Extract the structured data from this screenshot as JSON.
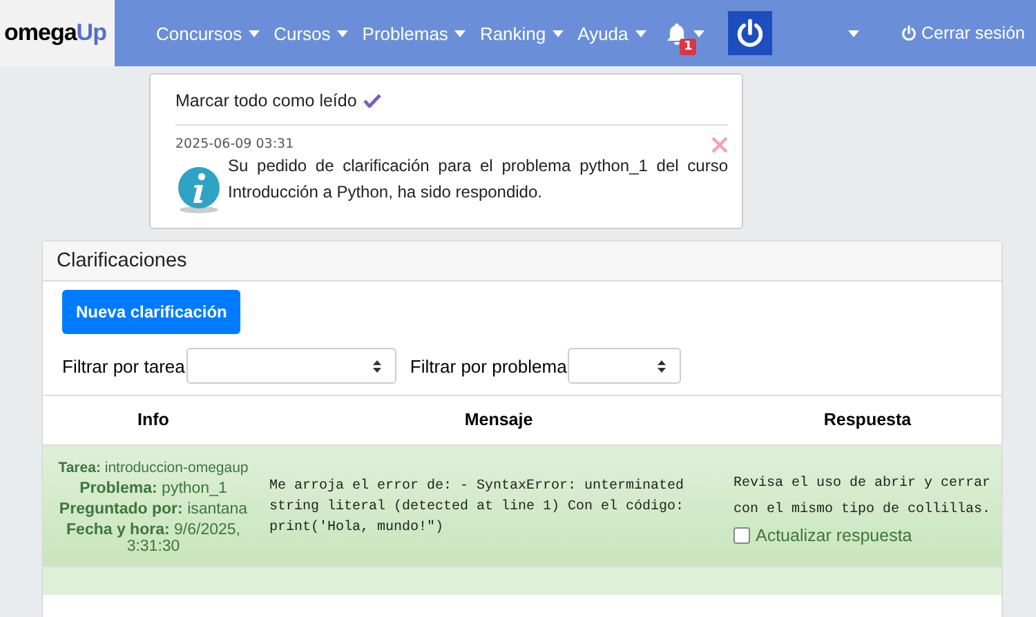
{
  "navbar": {
    "logo": {
      "part1": "omega",
      "part2": "Up"
    },
    "menus": [
      {
        "label": "Concursos"
      },
      {
        "label": "Cursos"
      },
      {
        "label": "Problemas"
      },
      {
        "label": "Ranking"
      },
      {
        "label": "Ayuda"
      }
    ],
    "notification_count": "1",
    "logout": "Cerrar sesión"
  },
  "notifications": {
    "mark_all": "Marcar todo como leído",
    "items": [
      {
        "date": "2025-06-09 03:31",
        "text": "Su pedido de clarificación para el problema python_1 del curso Introducción a Python, ha sido respondido."
      }
    ]
  },
  "panel": {
    "title": "Clarificaciones",
    "new_button": "Nueva clarificación",
    "filters": [
      {
        "label": "Filtrar por tarea",
        "kind": "wide"
      },
      {
        "label": "Filtrar por problema",
        "kind": "narrow"
      }
    ],
    "table": {
      "columns": [
        "Info",
        "Mensaje",
        "Respuesta"
      ],
      "rows": [
        {
          "info": [
            "**Tarea:** introduccion-omegaup",
            "**Problema:** python_1",
            "**Preguntado por:** isantana",
            "**Fecha y hora:** 9/6/2025, 3:31:30"
          ],
          "message": "Me arroja el error de: - SyntaxError: unterminated string literal (detected at line 1) Con el código: print('Hola, mundo!\")",
          "answer": "Revisa el uso de abrir y cerrar con el mismo tipo de collillas.",
          "update_label": "Actualizar respuesta",
          "update_checked": false
        }
      ]
    }
  }
}
